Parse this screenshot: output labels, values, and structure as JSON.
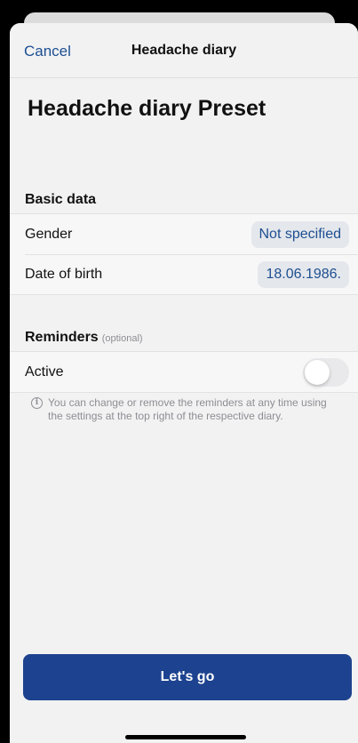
{
  "nav": {
    "cancel_label": "Cancel",
    "title": "Headache diary"
  },
  "page_title": "Headache diary Preset",
  "basic_data": {
    "header": "Basic data",
    "rows": [
      {
        "label": "Gender",
        "value": "Not specified"
      },
      {
        "label": "Date of birth",
        "value": "18.06.1986."
      }
    ]
  },
  "reminders": {
    "header": "Reminders",
    "optional_label": "(optional)",
    "active_label": "Active",
    "active_on": false,
    "info_text": "You can change or remove the reminders at any time using the settings at the top right of the respective diary."
  },
  "primary_button_label": "Let's go",
  "colors": {
    "accent": "#1d428f",
    "link": "#1d4f91",
    "background": "#f2f2f3"
  },
  "icons": {
    "info": "info-circle-icon"
  }
}
